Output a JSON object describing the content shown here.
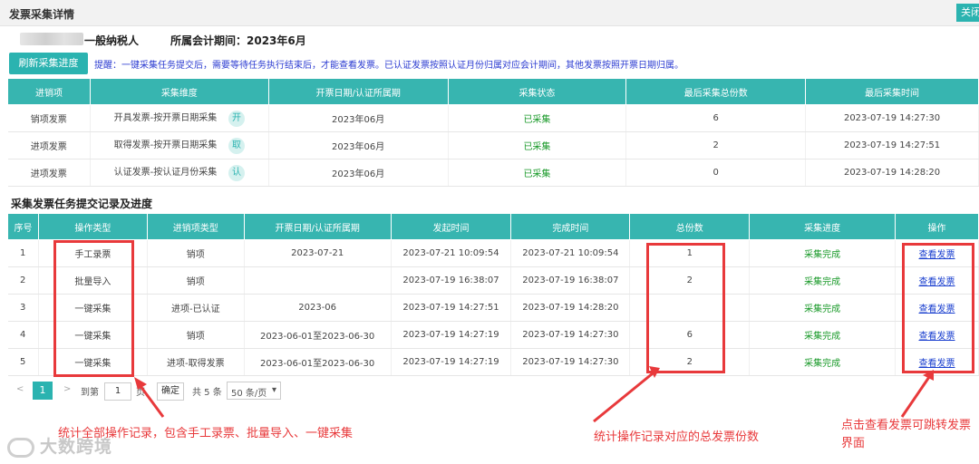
{
  "window": {
    "title": "发票采集详情",
    "close_label": "关闭"
  },
  "info": {
    "taxpayer_type": "一般纳税人",
    "period_label": "所属会计期间：2023年6月"
  },
  "toolbar": {
    "refresh_label": "刷新采集进度",
    "tip": "提醒：一键采集任务提交后，需要等待任务执行结束后，才能查看发票。已认证发票按照认证月份归属对应会计期间，其他发票按照开票日期归属。"
  },
  "table1": {
    "headers": [
      "进销项",
      "采集维度",
      "开票日期/认证所属期",
      "采集状态",
      "最后采集总份数",
      "最后采集时间"
    ],
    "rows": [
      {
        "type": "销项发票",
        "dimension": "开具发票-按开票日期采集",
        "badge": "开",
        "period": "2023年06月",
        "status": "已采集",
        "count": "6",
        "time": "2023-07-19 14:27:30"
      },
      {
        "type": "进项发票",
        "dimension": "取得发票-按开票日期采集",
        "badge": "取",
        "period": "2023年06月",
        "status": "已采集",
        "count": "2",
        "time": "2023-07-19 14:27:51"
      },
      {
        "type": "进项发票",
        "dimension": "认证发票-按认证月份采集",
        "badge": "认",
        "period": "2023年06月",
        "status": "已采集",
        "count": "0",
        "time": "2023-07-19 14:28:20"
      }
    ]
  },
  "section2_title": "采集发票任务提交记录及进度",
  "table2": {
    "headers": [
      "序号",
      "操作类型",
      "进销项类型",
      "开票日期/认证所属期",
      "发起时间",
      "完成时间",
      "总份数",
      "采集进度",
      "操作"
    ],
    "rows": [
      {
        "no": "1",
        "op": "手工录票",
        "kind": "销项",
        "period": "2023-07-21",
        "start": "2023-07-21 10:09:54",
        "end": "2023-07-21 10:09:54",
        "total": "1",
        "progress": "采集完成",
        "action": "查看发票"
      },
      {
        "no": "2",
        "op": "批量导入",
        "kind": "销项",
        "period": "",
        "start": "2023-07-19 16:38:07",
        "end": "2023-07-19 16:38:07",
        "total": "2",
        "progress": "采集完成",
        "action": "查看发票"
      },
      {
        "no": "3",
        "op": "一键采集",
        "kind": "进项-已认证",
        "period": "2023-06",
        "start": "2023-07-19 14:27:51",
        "end": "2023-07-19 14:28:20",
        "total": "",
        "progress": "采集完成",
        "action": "查看发票"
      },
      {
        "no": "4",
        "op": "一键采集",
        "kind": "销项",
        "period": "2023-06-01至2023-06-30",
        "start": "2023-07-19 14:27:19",
        "end": "2023-07-19 14:27:30",
        "total": "6",
        "progress": "采集完成",
        "action": "查看发票"
      },
      {
        "no": "5",
        "op": "一键采集",
        "kind": "进项-取得发票",
        "period": "2023-06-01至2023-06-30",
        "start": "2023-07-19 14:27:19",
        "end": "2023-07-19 14:27:30",
        "total": "2",
        "progress": "采集完成",
        "action": "查看发票"
      }
    ]
  },
  "pager": {
    "prev": "<",
    "current": "1",
    "next": ">",
    "goto_label": "到第",
    "goto_value": "1",
    "page_unit": "页",
    "confirm": "确定",
    "total": "共 5 条",
    "page_size": "50 条/页"
  },
  "annotations": {
    "left": "统计全部操作记录，包含手工录票、批量导入、一键采集",
    "middle": "统计操作记录对应的总发票份数",
    "right": "点击查看发票可跳转发票界面"
  },
  "watermark": "大数跨境",
  "colors": {
    "accent": "#37b5b0",
    "success": "#1a9a2a",
    "link": "#1a3fcf",
    "annotation": "#e8393b"
  }
}
